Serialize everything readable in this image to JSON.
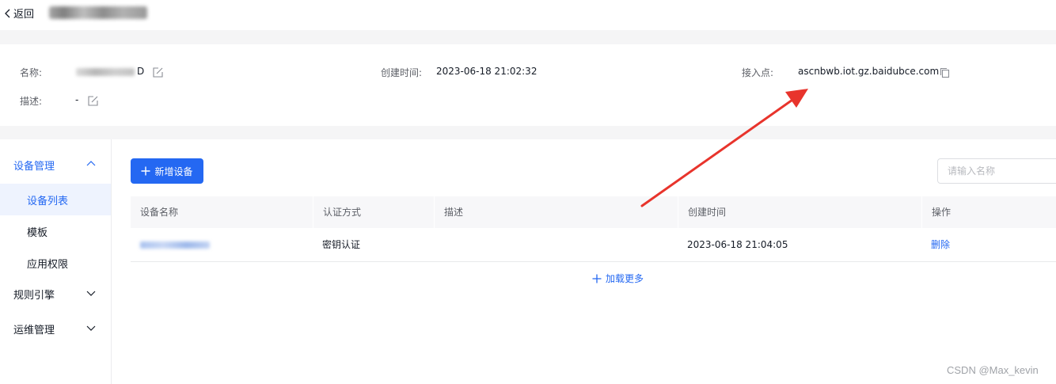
{
  "topbar": {
    "back_label": "返回",
    "title_obfuscated": "IoT_AUTO_CMD"
  },
  "info": {
    "name_label": "名称:",
    "name_value_tail": "D",
    "desc_label": "描述:",
    "desc_value": "-",
    "created_label": "创建时间:",
    "created_value": "2023-06-18 21:02:32",
    "endpoint_label": "接入点:",
    "endpoint_value": "ascnbwb.iot.gz.baidubce.com"
  },
  "sidebar": {
    "groups": [
      {
        "label": "设备管理",
        "expanded": true
      },
      {
        "label": "规则引擎",
        "expanded": false
      },
      {
        "label": "运维管理",
        "expanded": false
      }
    ],
    "items": [
      {
        "label": "设备列表",
        "active": true
      },
      {
        "label": "模板",
        "active": false
      },
      {
        "label": "应用权限",
        "active": false
      }
    ]
  },
  "main": {
    "add_button_label": "新增设备",
    "search_placeholder": "请输入名称",
    "table": {
      "columns": [
        "设备名称",
        "认证方式",
        "描述",
        "创建时间",
        "操作"
      ],
      "rows": [
        {
          "device_name": "",
          "auth": "密钥认证",
          "desc": "",
          "created": "2023-06-18 21:04:05",
          "action": "删除"
        }
      ]
    },
    "load_more_label": "加载更多"
  },
  "watermark": "CSDN @Max_kevin",
  "colors": {
    "primary": "#2468f2",
    "arrow": "#e8342c",
    "page_bg": "#f5f5f6"
  },
  "icons": [
    "chevron-left-icon",
    "edit-icon",
    "copy-icon",
    "chevron-up-icon",
    "chevron-down-icon",
    "plus-icon"
  ]
}
